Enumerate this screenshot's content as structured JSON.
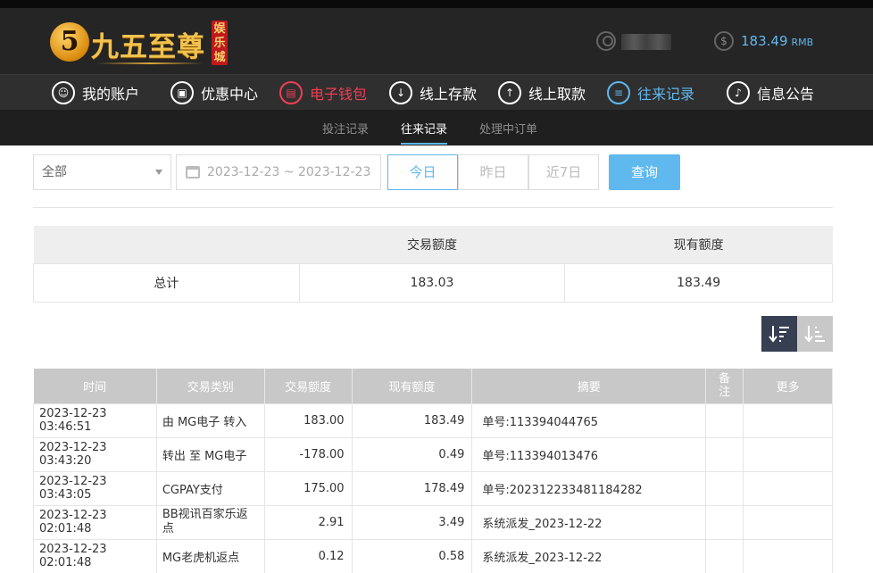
{
  "header": {
    "logo_number": "5",
    "logo_text": "九五至尊",
    "logo_badge": "娱乐城",
    "balance_icon": "$",
    "balance": "183.49",
    "currency": "RMB"
  },
  "nav": [
    {
      "label": "我的账户",
      "icon": "user-icon",
      "glyph": "☺"
    },
    {
      "label": "优惠中心",
      "icon": "gift-icon",
      "glyph": "▣"
    },
    {
      "label": "电子钱包",
      "icon": "wallet-icon",
      "glyph": "▤"
    },
    {
      "label": "线上存款",
      "icon": "deposit-icon",
      "glyph": "↓"
    },
    {
      "label": "线上取款",
      "icon": "withdraw-icon",
      "glyph": "↑"
    },
    {
      "label": "往来记录",
      "icon": "record-icon",
      "glyph": "≡"
    },
    {
      "label": "信息公告",
      "icon": "bell-icon",
      "glyph": "♪"
    }
  ],
  "subnav": [
    "投注记录",
    "往来记录",
    "处理中订单"
  ],
  "filter": {
    "type_selected": "全部",
    "date_range": "2023-12-23 ~ 2023-12-23",
    "today": "今日",
    "yesterday": "昨日",
    "last7": "近7日",
    "query": "查询"
  },
  "summary": {
    "headers": [
      "",
      "交易额度",
      "现有额度"
    ],
    "row": [
      "总计",
      "183.03",
      "183.49"
    ]
  },
  "records": {
    "headers": [
      "时间",
      "交易类别",
      "交易额度",
      "现有额度",
      "摘要",
      "备注",
      "更多"
    ],
    "rows": [
      [
        "2023-12-23 03:46:51",
        "由 MG电子 转入",
        "183.00",
        "183.49",
        "单号:113394044765",
        "",
        ""
      ],
      [
        "2023-12-23 03:43:20",
        "转出 至 MG电子",
        "-178.00",
        "0.49",
        "单号:113394013476",
        "",
        ""
      ],
      [
        "2023-12-23 03:43:05",
        "CGPAY支付",
        "175.00",
        "178.49",
        "单号:202312233481184282",
        "",
        ""
      ],
      [
        "2023-12-23 02:01:48",
        "BB视讯百家乐返点",
        "2.91",
        "3.49",
        "系统派发_2023-12-22",
        "",
        ""
      ],
      [
        "2023-12-23 02:01:48",
        "MG老虎机返点",
        "0.12",
        "0.58",
        "系统派发_2023-12-22",
        "",
        ""
      ]
    ]
  },
  "colors": {
    "accent": "#5fb8ee",
    "active_red": "#ef3f55",
    "header_bg": "#252525",
    "sort_active": "#364052"
  }
}
